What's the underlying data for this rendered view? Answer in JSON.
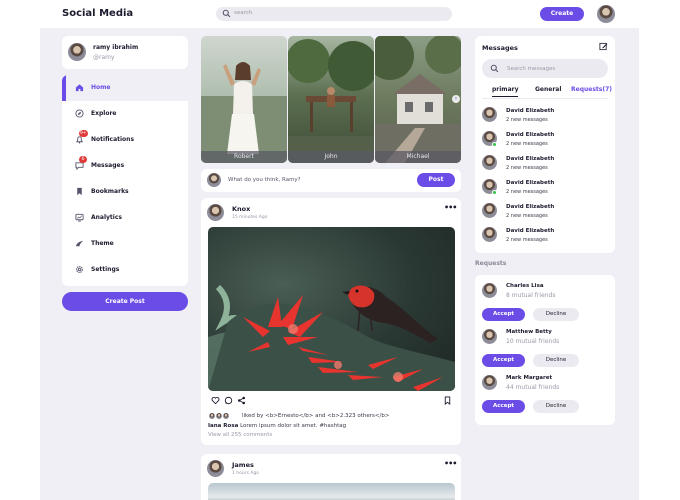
{
  "app": {
    "title": "Social Media"
  },
  "search": {
    "placeholder": "search"
  },
  "header": {
    "create_label": "Create"
  },
  "profile": {
    "name": "ramy ibrahim",
    "handle": "@ramy"
  },
  "sidebar": {
    "items": [
      {
        "label": "Home",
        "icon": "home-icon",
        "active": true
      },
      {
        "label": "Explore",
        "icon": "compass-icon"
      },
      {
        "label": "Notifications",
        "icon": "bell-icon",
        "badge": "9+"
      },
      {
        "label": "Messages",
        "icon": "chat-icon",
        "badge": "6"
      },
      {
        "label": "Bookmarks",
        "icon": "bookmark-icon"
      },
      {
        "label": "Analytics",
        "icon": "analytics-icon"
      },
      {
        "label": "Theme",
        "icon": "palette-icon"
      },
      {
        "label": "Settings",
        "icon": "gear-icon"
      }
    ],
    "create_post_label": "Create Post"
  },
  "stories": [
    {
      "name": "Robert"
    },
    {
      "name": "John"
    },
    {
      "name": "Michael"
    }
  ],
  "composer": {
    "placeholder": "What do you think, Ramy?",
    "post_label": "Post"
  },
  "posts": [
    {
      "author": "Knox",
      "time": "15 minutes Ago",
      "liked_by": "liked by <b>Ernesto</b> and <b>2.323 others</b>",
      "caption_author": "Iana Rosa",
      "caption_text": "Lorem ipsum dolor sit amet. #hashtag",
      "comments": "View all 255 comments"
    },
    {
      "author": "James",
      "time": "1 hours Ago"
    }
  ],
  "messages": {
    "title": "Messages",
    "search_placeholder": "Search messages",
    "tabs": [
      "primary",
      "General",
      "Requests(7)"
    ],
    "items": [
      {
        "name": "David Elizabeth",
        "text": "2 new messages",
        "online": false
      },
      {
        "name": "David Elizabeth",
        "text": "2 new messages",
        "online": true
      },
      {
        "name": "David Elizabeth",
        "text": "2 new messages",
        "online": false
      },
      {
        "name": "David Elizabeth",
        "text": "2 new messages",
        "online": true
      },
      {
        "name": "David Elizabeth",
        "text": "2 new messages",
        "online": false
      },
      {
        "name": "David Elizabeth",
        "text": "2 new messages",
        "online": false
      }
    ]
  },
  "requests": {
    "title": "Requests",
    "accept_label": "Accept",
    "decline_label": "Decline",
    "items": [
      {
        "name": "Charles Lisa",
        "mutual": "8 mutual friends"
      },
      {
        "name": "Matthew Betty",
        "mutual": "10 mutual friends"
      },
      {
        "name": "Mark Margaret",
        "mutual": "44 mutual friends"
      }
    ]
  },
  "colors": {
    "accent": "#6b4ce6",
    "background": "#f0eff5",
    "card": "#ffffff",
    "badge": "#e03b3b",
    "online": "#37c24b"
  }
}
